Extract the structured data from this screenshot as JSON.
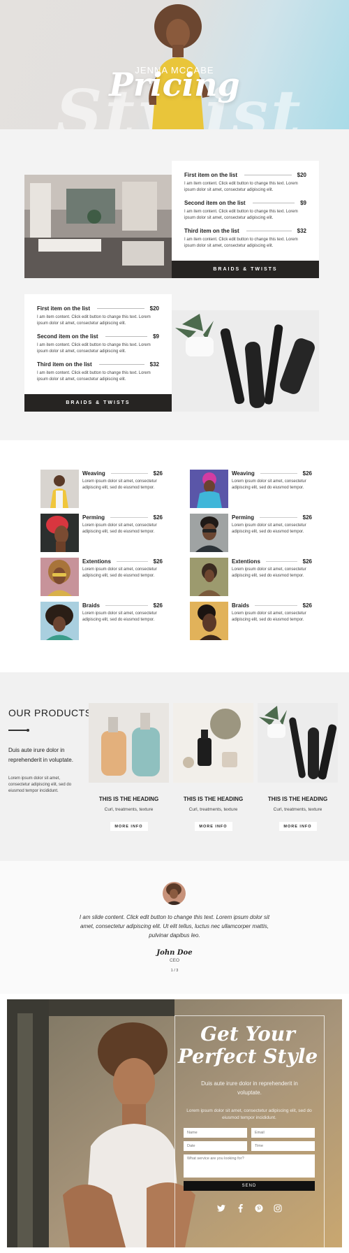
{
  "colors": {
    "dark_bar": "#262422",
    "hero_blue": "#a9dbe8",
    "accent_yellow": "#e9c53a"
  },
  "hero": {
    "subtitle": "JENNA MCCABE",
    "title": "Pricing",
    "background_word": "Stylist"
  },
  "pricing": {
    "cards": [
      {
        "items": [
          {
            "name": "First item on the list",
            "price": "$20",
            "desc": "I am item content. Click edit button to change this text. Lorem ipsum dolor sit amet, consectetur adipiscing elit."
          },
          {
            "name": "Second item on the list",
            "price": "$9",
            "desc": "I am item content. Click edit button to change this text. Lorem ipsum dolor sit amet, consectetur adipiscing elit."
          },
          {
            "name": "Third item on the list",
            "price": "$32",
            "desc": "I am item content. Click edit button to change this text. Lorem ipsum dolor sit amet, consectetur adipiscing elit."
          }
        ],
        "footer": "BRAIDS & TWISTS"
      },
      {
        "items": [
          {
            "name": "First item on the list",
            "price": "$20",
            "desc": "I am item content. Click edit button to change this text. Lorem ipsum dolor sit amet, consectetur adipiscing elit."
          },
          {
            "name": "Second item on the list",
            "price": "$9",
            "desc": "I am item content. Click edit button to change this text. Lorem ipsum dolor sit amet, consectetur adipiscing elit."
          },
          {
            "name": "Third item on the list",
            "price": "$32",
            "desc": "I am item content. Click edit button to change this text. Lorem ipsum dolor sit amet, consectetur adipiscing elit."
          }
        ],
        "footer": "BRAIDS & TWISTS"
      }
    ]
  },
  "services": {
    "left": [
      {
        "name": "Weaving",
        "price": "$26",
        "desc": "Lorem ipsum dolor sit amet, consectetur adipiscing elit, sed do eiusmod tempor."
      },
      {
        "name": "Perming",
        "price": "$26",
        "desc": "Lorem ipsum dolor sit amet, consectetur adipiscing elit, sed do eiusmod tempor."
      },
      {
        "name": "Extentions",
        "price": "$26",
        "desc": "Lorem ipsum dolor sit amet, consectetur adipiscing elit, sed do eiusmod tempor."
      },
      {
        "name": "Braids",
        "price": "$26",
        "desc": "Lorem ipsum dolor sit amet, consectetur adipiscing elit, sed do eiusmod tempor."
      }
    ],
    "right": [
      {
        "name": "Weaving",
        "price": "$26",
        "desc": "Lorem ipsum dolor sit amet, consectetur adipiscing elit, sed do eiusmod tempor."
      },
      {
        "name": "Perming",
        "price": "$26",
        "desc": "Lorem ipsum dolor sit amet, consectetur adipiscing elit, sed do eiusmod tempor."
      },
      {
        "name": "Extentions",
        "price": "$26",
        "desc": "Lorem ipsum dolor sit amet, consectetur adipiscing elit, sed do eiusmod tempor."
      },
      {
        "name": "Braids",
        "price": "$26",
        "desc": "Lorem ipsum dolor sit amet, consectetur adipiscing elit, sed do eiusmod tempor."
      }
    ]
  },
  "products": {
    "title": "OUR PRODUCTS",
    "lead": "Duis aute irure dolor in reprehenderit in voluptate.",
    "text": "Lorem ipsum dolor sit amet, consectetur adipiscing elit, sed do eiusmod tempor incididunt.",
    "cards": [
      {
        "heading": "THIS IS THE HEADING",
        "sub": "Curl, treatments, texture",
        "button": "MORE INFO"
      },
      {
        "heading": "THIS IS THE HEADING",
        "sub": "Curl, treatments, texture",
        "button": "MORE INFO"
      },
      {
        "heading": "THIS IS THE HEADING",
        "sub": "Curl, treatments, texture",
        "button": "MORE INFO"
      }
    ]
  },
  "testimonial": {
    "quote": "I am slide content. Click edit button to change this text. Lorem ipsum dolor sit amet, consectetur adipiscing elit. Ut elit tellus, luctus nec ullamcorper mattis, pulvinar dapibus leo.",
    "signature": "John Doe",
    "role": "CEO",
    "slide_count": "1 / 3"
  },
  "contact": {
    "title_line1": "Get Your",
    "title_line2": "Perfect Style",
    "lead": "Duis aute irure dolor in reprehenderit in voluptate.",
    "text": "Lorem ipsum dolor sit amet, consectetur adipiscing elit, sed do eiusmod tempor incididunt.",
    "name_placeholder": "Name",
    "email_placeholder": "Email",
    "date_placeholder": "Date",
    "time_placeholder": "Time",
    "service_placeholder": "What service are you looking for?",
    "send_label": "SEND",
    "socials": [
      "twitter-icon",
      "facebook-icon",
      "pinterest-icon",
      "instagram-icon"
    ]
  }
}
